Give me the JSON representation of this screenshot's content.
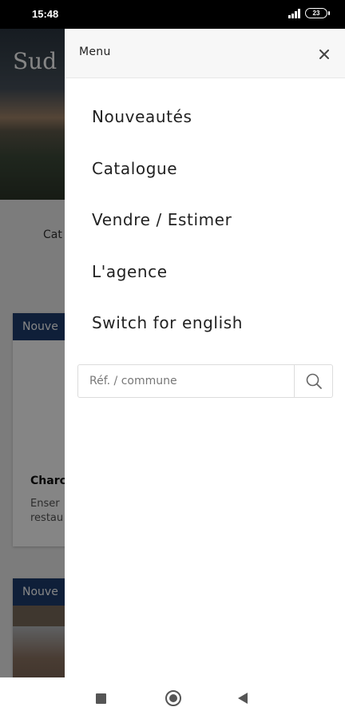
{
  "status_bar": {
    "time": "15:48",
    "battery": "23"
  },
  "background_page": {
    "hero_title": "Sud I",
    "nav_partial": "Cat",
    "card_1": {
      "badge": "Nouve",
      "title": "Charc",
      "desc_line_1": "Enser",
      "desc_line_2": "restau"
    },
    "card_2": {
      "badge": "Nouve"
    }
  },
  "drawer": {
    "title": "Menu",
    "menu_items": [
      {
        "label": "Nouveautés"
      },
      {
        "label": "Catalogue"
      },
      {
        "label": "Vendre / Estimer"
      },
      {
        "label": "L'agence"
      },
      {
        "label": "Switch for english"
      }
    ],
    "search": {
      "placeholder": "Réf. / commune",
      "value": ""
    }
  },
  "colors": {
    "badge_blue": "#1d3d6e",
    "drawer_header_bg": "#f7f7f7",
    "overlay": "rgba(0,0,0,0.48)"
  },
  "icons": {
    "close": "close-icon",
    "search": "search-icon",
    "nav_recent": "recent-apps-icon",
    "nav_home": "home-icon",
    "nav_back": "back-icon"
  }
}
